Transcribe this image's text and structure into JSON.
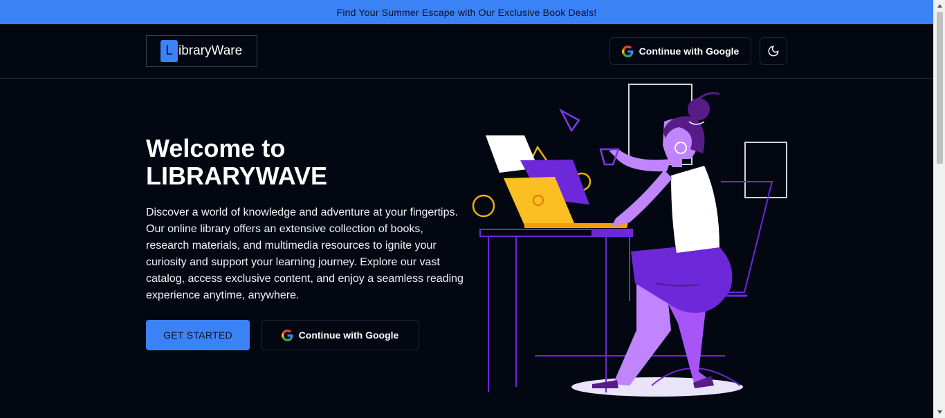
{
  "banner": {
    "text": "Find Your Summer Escape with Our Exclusive Book Deals!"
  },
  "navbar": {
    "logo_letter": "L",
    "logo_text": "ibraryWare",
    "google_label": "Continue with Google",
    "theme_toggle_icon": "moon-icon"
  },
  "hero": {
    "title_line1": "Welcome to",
    "title_line2": "LIBRARYWAVE",
    "description": "Discover a world of knowledge and adventure at your fingertips. Our online library offers an extensive collection of books, research materials, and multimedia resources to ignite your curiosity and support your learning journey. Explore our vast catalog, access exclusive content, and enjoy a seamless reading experience anytime, anywhere.",
    "cta_label": "GET STARTED",
    "google_label": "Continue with Google"
  },
  "colors": {
    "background": "#030712",
    "banner": "#3b82f6",
    "accent": "#3b82f6",
    "illustration_purple": "#c084fc",
    "illustration_violet": "#6d28d9",
    "illustration_yellow": "#fbbf24"
  }
}
